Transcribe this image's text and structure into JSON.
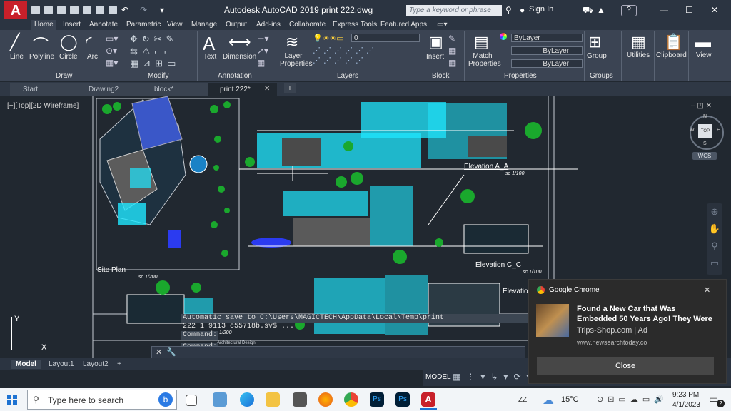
{
  "window": {
    "title": "Autodesk AutoCAD 2019    print 222.dwg",
    "search_placeholder": "Type a keyword or phrase",
    "sign_in": "Sign In",
    "app_logo": "A"
  },
  "ribbon": {
    "tabs": [
      "Home",
      "Insert",
      "Annotate",
      "Parametric",
      "View",
      "Manage",
      "Output",
      "Add-ins",
      "Collaborate",
      "Express Tools",
      "Featured Apps"
    ],
    "panels": {
      "draw": {
        "label": "Draw",
        "tools": [
          "Line",
          "Polyline",
          "Circle",
          "Arc"
        ]
      },
      "modify": {
        "label": "Modify"
      },
      "annotation": {
        "label": "Annotation",
        "tools": [
          "Text",
          "Dimension"
        ]
      },
      "layers": {
        "label": "Layers",
        "tool": "Layer Properties",
        "layer_value": "0"
      },
      "block": {
        "label": "Block",
        "tool": "Insert"
      },
      "properties": {
        "label": "Properties",
        "tool": "Match Properties",
        "color": "ByLayer",
        "linetype": "ByLayer",
        "lineweight": "ByLayer"
      },
      "groups": {
        "label": "Groups",
        "tool": "Group"
      },
      "utilities": {
        "label": "Utilities"
      },
      "clipboard": {
        "label": "Clipboard"
      },
      "view": {
        "label": "View"
      }
    }
  },
  "file_tabs": [
    "Start",
    "Drawing2",
    "block*",
    "print 222*"
  ],
  "canvas": {
    "view_label": "[−][Top][2D Wireframe]",
    "labels": {
      "elevation_aa": "Elevation A_A",
      "elevation_cc": "Elevation C_C",
      "elevation_partial": "Elevatio",
      "site_plan": "Site Plan",
      "scale": "sc 1/100",
      "scale_site": "sc 1/200",
      "arch_design": "Architectural Design"
    },
    "viewcube": {
      "north": "N",
      "south": "S",
      "east": "E",
      "west": "W",
      "top": "TOP",
      "wcs": "WCS"
    },
    "ucs": {
      "y": "Y",
      "x": "X"
    }
  },
  "command": {
    "history": [
      "Automatic save to C:\\Users\\MAGICTECH\\AppData\\Local\\Temp\\print 222_1_9113_c55718b.sv$ ...",
      "Command:",
      "Command:"
    ],
    "prompt": ""
  },
  "layout_tabs": [
    "Model",
    "Layout1",
    "Layout2"
  ],
  "status": {
    "model": "MODEL"
  },
  "taskbar": {
    "search_placeholder": "Type here to search",
    "weather": "15°C",
    "time": "9:23 PM",
    "date": "4/1/2023",
    "lang": "ZZ",
    "notif_count": "2"
  },
  "notification": {
    "app": "Google Chrome",
    "title": "Found a New Car that Was Embedded 50 Years Ago! They Were S",
    "source": "Trips-Shop.com | Ad",
    "url": "www.newsearchtoday.co",
    "close_label": "Close"
  },
  "colors": {
    "accent": "#c8202a",
    "cyan": "#1fe7ff",
    "green": "#1aa82d",
    "blue": "#2b3bf0"
  }
}
